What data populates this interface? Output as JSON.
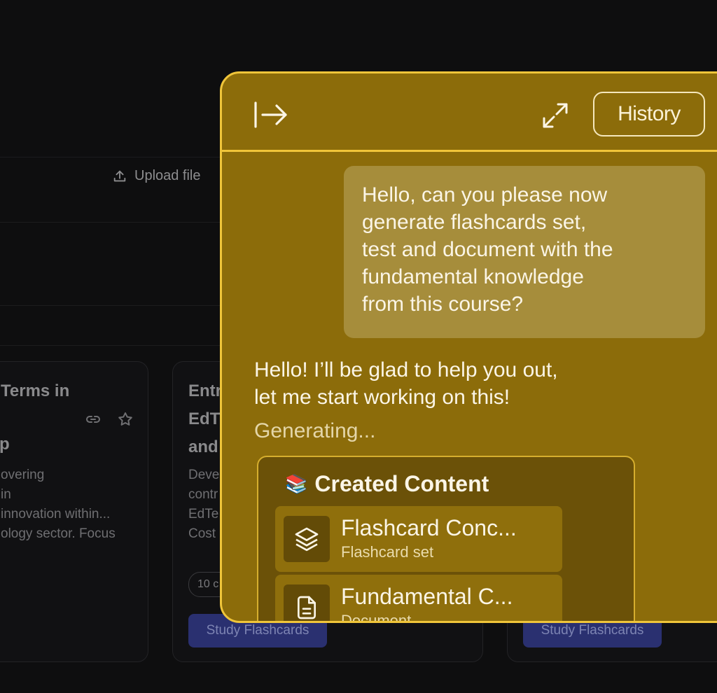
{
  "toolbar": {
    "upload_label": "Upload file"
  },
  "cards": [
    {
      "title_line1": "Terms in",
      "title_line2": "p",
      "description": [
        "overing",
        " in",
        "innovation within...",
        "ology sector. Focus"
      ]
    },
    {
      "title_lines": [
        "Entr",
        "EdT",
        "and"
      ],
      "description": [
        "Deve",
        "contr",
        "EdTe",
        "Cost"
      ],
      "count_pill": "10 c",
      "study_label": "Study Flashcards"
    },
    {
      "study_label": "Study Flashcards"
    }
  ],
  "chat": {
    "history_label": "History",
    "user_message": [
      "Hello, can you please now",
      "generate flashcards set,",
      "test and document with the",
      "fundamental knowledge",
      "from this course?"
    ],
    "assistant_message": [
      "Hello! I’ll be glad to help you out,",
      "let me start working on this!"
    ],
    "status": "Generating...",
    "created": {
      "emoji": "📚",
      "title": "Created Content",
      "items": [
        {
          "title": "Flashcard Conc...",
          "type": "Flashcard set",
          "icon": "layers-icon"
        },
        {
          "title": "Fundamental C...",
          "type": "Document",
          "icon": "document-icon"
        }
      ]
    }
  },
  "colors": {
    "panel_bg": "#8c6c0a",
    "panel_border": "#f0c53a",
    "bubble_bg": "#a68d3b",
    "created_bg": "#6b5108",
    "study_button": "#2a3070"
  }
}
